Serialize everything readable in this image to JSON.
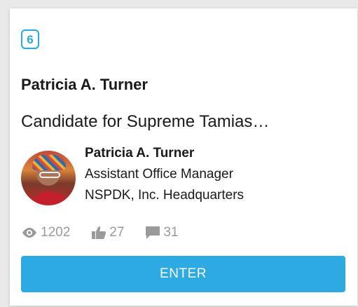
{
  "card": {
    "badge_number": "6",
    "author": "Patricia A. Turner",
    "title": "Candidate for Supreme Tamias…",
    "profile": {
      "name": "Patricia A. Turner",
      "role": "Assistant Office Manager",
      "organization": "NSPDK, Inc. Headquarters"
    },
    "stats": {
      "views": "1202",
      "likes": "27",
      "comments": "31"
    },
    "enter_label": "ENTER"
  },
  "colors": {
    "accent": "#2eaae3",
    "badge": "#29a8e0",
    "stat_gray": "#9a9a9a"
  },
  "icons": {
    "views": "eye-icon",
    "likes": "thumbs-up-icon",
    "comments": "comment-icon"
  }
}
